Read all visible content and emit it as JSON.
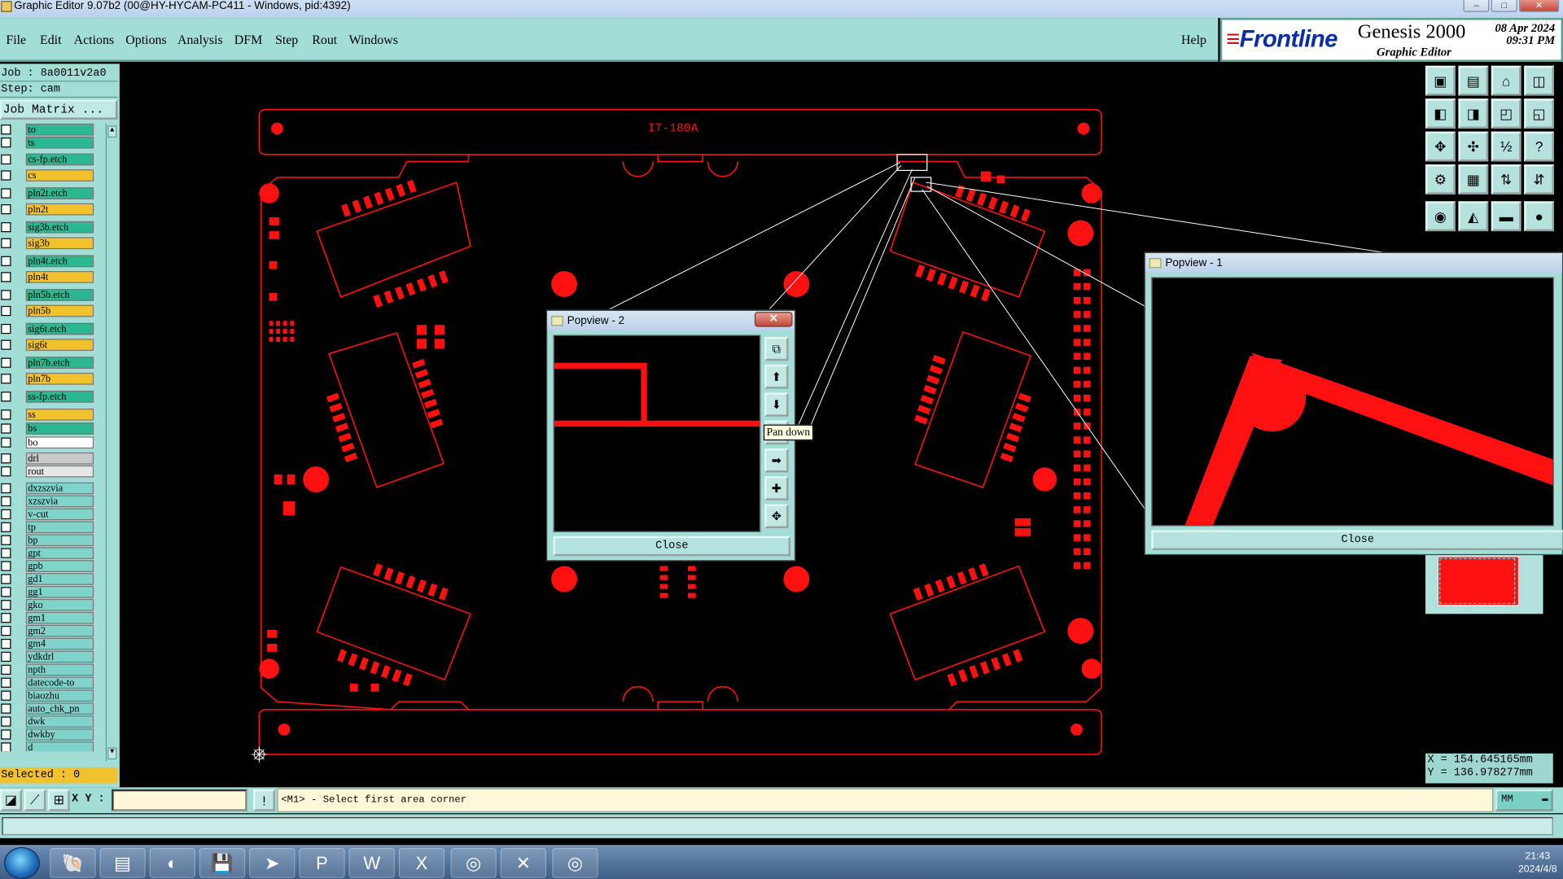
{
  "window": {
    "title": "Graphic Editor 9.07b2 (00@HY-HYCAM-PC411 - Windows, pid:4392)"
  },
  "menu": {
    "items": [
      "File",
      "Edit",
      "Actions",
      "Options",
      "Analysis",
      "DFM",
      "Step",
      "Rout",
      "Windows"
    ],
    "help": "Help"
  },
  "brand": {
    "logo": "Frontline",
    "product": "Genesis 2000",
    "subtitle": "Graphic Editor",
    "date": "08 Apr 2024",
    "time": "09:31 PM"
  },
  "job": {
    "job_line": "Job : 8a0011v2a0",
    "step_line": "Step: cam",
    "matrix_button": "Job Matrix ..."
  },
  "layers": [
    {
      "name": "to",
      "color": "#2bb890"
    },
    {
      "name": "ts",
      "color": "#2bb890"
    },
    {
      "name": "cs-fp.etch",
      "color": "#2bb890"
    },
    {
      "name": "cs",
      "color": "#f2c22e"
    },
    {
      "name": "pln2t.etch",
      "color": "#2bb890"
    },
    {
      "name": "pln2t",
      "color": "#f2c22e"
    },
    {
      "name": "sig3b.etch",
      "color": "#2bb890"
    },
    {
      "name": "sig3b",
      "color": "#f2c22e"
    },
    {
      "name": "pln4t.etch",
      "color": "#2bb890"
    },
    {
      "name": "pln4t",
      "color": "#f2c22e"
    },
    {
      "name": "pln5b.etch",
      "color": "#2bb890"
    },
    {
      "name": "pln5b",
      "color": "#f2c22e"
    },
    {
      "name": "sig6t.etch",
      "color": "#2bb890"
    },
    {
      "name": "sig6t",
      "color": "#f2c22e"
    },
    {
      "name": "pln7b.etch",
      "color": "#2bb890"
    },
    {
      "name": "pln7b",
      "color": "#f2c22e"
    },
    {
      "name": "ss-fp.etch",
      "color": "#2bb890"
    },
    {
      "name": "ss",
      "color": "#f2c22e"
    },
    {
      "name": "bs",
      "color": "#2bb890"
    },
    {
      "name": "bo",
      "color": "#ffffff"
    },
    {
      "name": "drl",
      "color": "#c8c8c8"
    },
    {
      "name": "rout",
      "color": "#e6e6e6"
    },
    {
      "name": "dxzszvia",
      "color": "#7fd3ca"
    },
    {
      "name": "xzszvia",
      "color": "#7fd3ca"
    },
    {
      "name": "v-cut",
      "color": "#7fd3ca"
    },
    {
      "name": "tp",
      "color": "#7fd3ca"
    },
    {
      "name": "bp",
      "color": "#7fd3ca"
    },
    {
      "name": "gpt",
      "color": "#7fd3ca"
    },
    {
      "name": "gpb",
      "color": "#7fd3ca"
    },
    {
      "name": "gd1",
      "color": "#7fd3ca"
    },
    {
      "name": "gg1",
      "color": "#7fd3ca"
    },
    {
      "name": "gko",
      "color": "#7fd3ca"
    },
    {
      "name": "gm1",
      "color": "#7fd3ca"
    },
    {
      "name": "gm2",
      "color": "#7fd3ca"
    },
    {
      "name": "gm4",
      "color": "#7fd3ca"
    },
    {
      "name": "ydkdrl",
      "color": "#7fd3ca"
    },
    {
      "name": "npth",
      "color": "#7fd3ca"
    },
    {
      "name": "datecode-to",
      "color": "#7fd3ca"
    },
    {
      "name": "biaozhu",
      "color": "#7fd3ca"
    },
    {
      "name": "auto_chk_pn",
      "color": "#7fd3ca"
    },
    {
      "name": "dwk",
      "color": "#7fd3ca"
    },
    {
      "name": "dwkby",
      "color": "#7fd3ca"
    },
    {
      "name": "d",
      "color": "#7fd3ca"
    }
  ],
  "status": {
    "selected": "Selected : 0",
    "xy_label": "X Y :",
    "prompt": "<M1> - Select first area corner",
    "units": "MM",
    "coord_x": "X = 154.645165mm",
    "coord_y": "Y = 136.978277mm"
  },
  "board": {
    "label": "IT-180A",
    "trace_color": "#ff1010"
  },
  "popview2": {
    "title": "Popview - 2",
    "close": "Close",
    "tooltip": "Pan down"
  },
  "popview1": {
    "title": "Popview - 1",
    "close": "Close"
  },
  "taskbar": {
    "time": "21:43",
    "date": "2024/4/8"
  }
}
